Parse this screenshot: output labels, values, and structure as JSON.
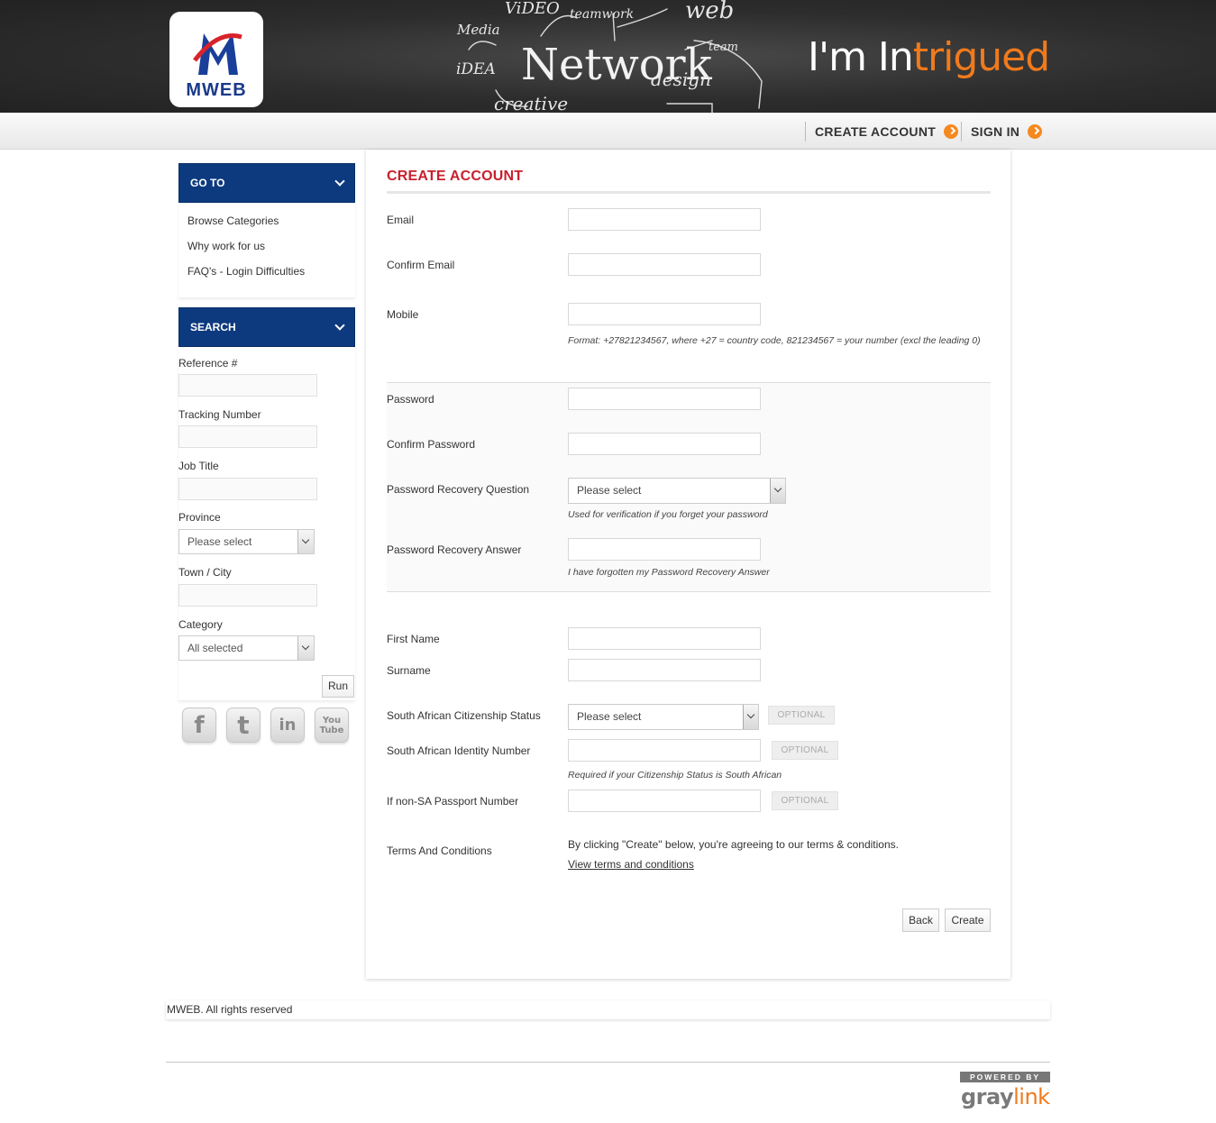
{
  "header": {
    "logo_text": "MWEB",
    "chalk_words": [
      "ViDEO",
      "teamwork",
      "web",
      "Media",
      "team",
      "iDEA",
      "Network",
      "design",
      "creative"
    ],
    "tagline_prefix": "I'm In",
    "tagline_accent": "trigued"
  },
  "topnav": {
    "create_account": "CREATE ACCOUNT",
    "sign_in": "SIGN IN"
  },
  "sidebar": {
    "goto_title": "GO TO",
    "links": [
      "Browse Categories",
      "Why work for us",
      "FAQ's - Login Difficulties"
    ],
    "search_title": "SEARCH",
    "reference_label": "Reference #",
    "tracking_label": "Tracking Number",
    "job_title_label": "Job Title",
    "province_label": "Province",
    "province_value": "Please select",
    "town_label": "Town / City",
    "category_label": "Category",
    "category_value": "All selected",
    "run_label": "Run"
  },
  "social": {
    "facebook": "f",
    "twitter": "t",
    "linkedin": "in",
    "youtube": "You Tube"
  },
  "form": {
    "title": "CREATE ACCOUNT",
    "email_label": "Email",
    "confirm_email_label": "Confirm Email",
    "mobile_label": "Mobile",
    "mobile_hint": "Format: +27821234567, where +27 = country code, 821234567 = your number (excl the leading 0)",
    "password_label": "Password",
    "confirm_password_label": "Confirm Password",
    "recovery_question_label": "Password Recovery Question",
    "recovery_question_value": "Please select",
    "recovery_question_hint": "Used for verification if you forget your password",
    "recovery_answer_label": "Password Recovery Answer",
    "recovery_answer_hint": "I have forgotten my Password Recovery Answer",
    "first_name_label": "First Name",
    "surname_label": "Surname",
    "citizenship_label": "South African Citizenship Status",
    "citizenship_value": "Please select",
    "id_number_label": "South African Identity Number",
    "id_number_hint": "Required if your Citizenship Status is South African",
    "passport_label": "If non-SA Passport Number",
    "optional_badge": "OPTIONAL",
    "terms_label": "Terms And Conditions",
    "terms_text": "By clicking \"Create\" below, you're agreeing to our terms & conditions.",
    "terms_link": "View terms and conditions",
    "back_label": "Back",
    "create_label": "Create"
  },
  "footer": {
    "copyright": "MWEB. All rights reserved",
    "powered_by": "POWERED BY",
    "brand_main": "gray",
    "brand_accent": "link"
  },
  "colors": {
    "brand_blue": "#0d3a7e",
    "title_red": "#c8202c",
    "accent_orange": "#f5891f"
  }
}
